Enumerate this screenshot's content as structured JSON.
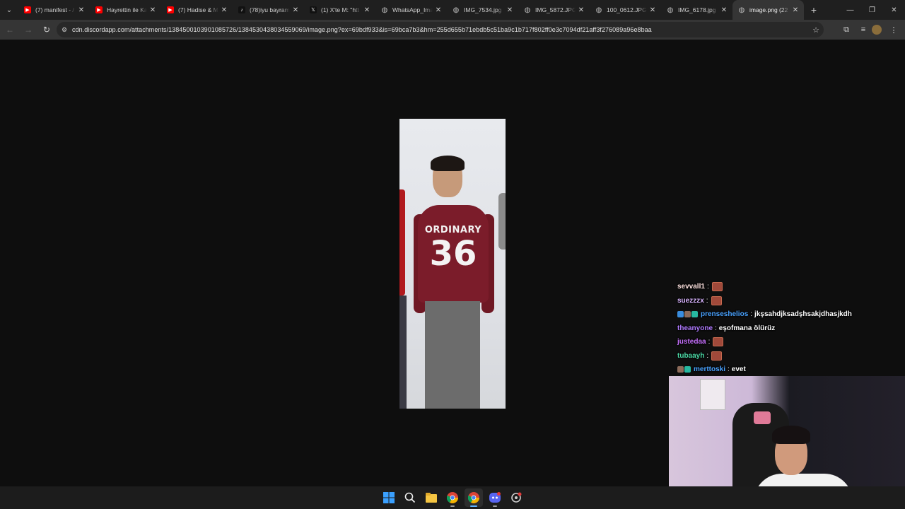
{
  "browser": {
    "tabs": [
      {
        "label": "(7) manifest - /",
        "favicon": "youtube-icon",
        "color": "#ff0000",
        "active": false
      },
      {
        "label": "Hayrettin ile Ka",
        "favicon": "youtube-icon",
        "color": "#ff0000",
        "active": false
      },
      {
        "label": "(7) Hadise & M",
        "favicon": "youtube-icon",
        "color": "#ff0000",
        "active": false
      },
      {
        "label": "(78)iyu bayram",
        "favicon": "tiktok-icon",
        "color": "#111111",
        "active": false
      },
      {
        "label": "(1) X'te M: \"htt",
        "favicon": "x-icon",
        "color": "#111111",
        "active": false
      },
      {
        "label": "WhatsApp_Ima",
        "favicon": "globe-icon",
        "color": "#5a5a5a",
        "active": false
      },
      {
        "label": "IMG_7534.jpg",
        "favicon": "globe-icon",
        "color": "#5a5a5a",
        "active": false
      },
      {
        "label": "IMG_5872.JPG",
        "favicon": "globe-icon",
        "color": "#5a5a5a",
        "active": false
      },
      {
        "label": "100_0612.JPG",
        "favicon": "globe-icon",
        "color": "#5a5a5a",
        "active": false
      },
      {
        "label": "IMG_6178.jpg",
        "favicon": "globe-icon",
        "color": "#5a5a5a",
        "active": false
      },
      {
        "label": "image.png (22",
        "favicon": "globe-icon",
        "color": "#5a5a5a",
        "active": true
      }
    ],
    "url": "cdn.discordapp.com/attachments/1384500103901085726/1384530438034559069/image.png?ex=69bdf933&is=69bca7b3&hm=255d655b71ebdb5c51ba9c1b717f802ff0e3c7094df21aff3f276089a96e8baa"
  },
  "photo": {
    "sweater_word": "ORDINARY",
    "sweater_number": "36"
  },
  "chat": {
    "messages": [
      {
        "user": "sevvall1",
        "color": "#ffe4e1",
        "text": "",
        "emote": true,
        "badges": []
      },
      {
        "user": "suezzzx",
        "color": "#d8b4ff",
        "text": "",
        "emote": true,
        "badges": []
      },
      {
        "user": "prenseshelios",
        "color": "#4aa3ff",
        "text": "jkşsahdjksadşhsakjdhasjkdh",
        "emote": false,
        "badges": [
          "#3a8dde",
          "#8d6b5a",
          "#27b8a0"
        ]
      },
      {
        "user": "theanyone",
        "color": "#b07aff",
        "text": "eşofmana ölürüz",
        "emote": false,
        "badges": []
      },
      {
        "user": "justedaa",
        "color": "#c872ff",
        "text": "",
        "emote": true,
        "badges": []
      },
      {
        "user": "tubaayh",
        "color": "#4cd9a6",
        "text": "",
        "emote": true,
        "badges": []
      },
      {
        "user": "merttoski",
        "color": "#4aa3ff",
        "text": "evet",
        "emote": false,
        "badges": [
          "#8d6b5a",
          "#27b8a0"
        ]
      }
    ]
  },
  "taskbar": {
    "icons": [
      "windows-start-icon",
      "search-icon",
      "file-explorer-icon",
      "chrome-icon",
      "chrome-active-icon",
      "discord-icon",
      "settings-app-icon"
    ]
  }
}
